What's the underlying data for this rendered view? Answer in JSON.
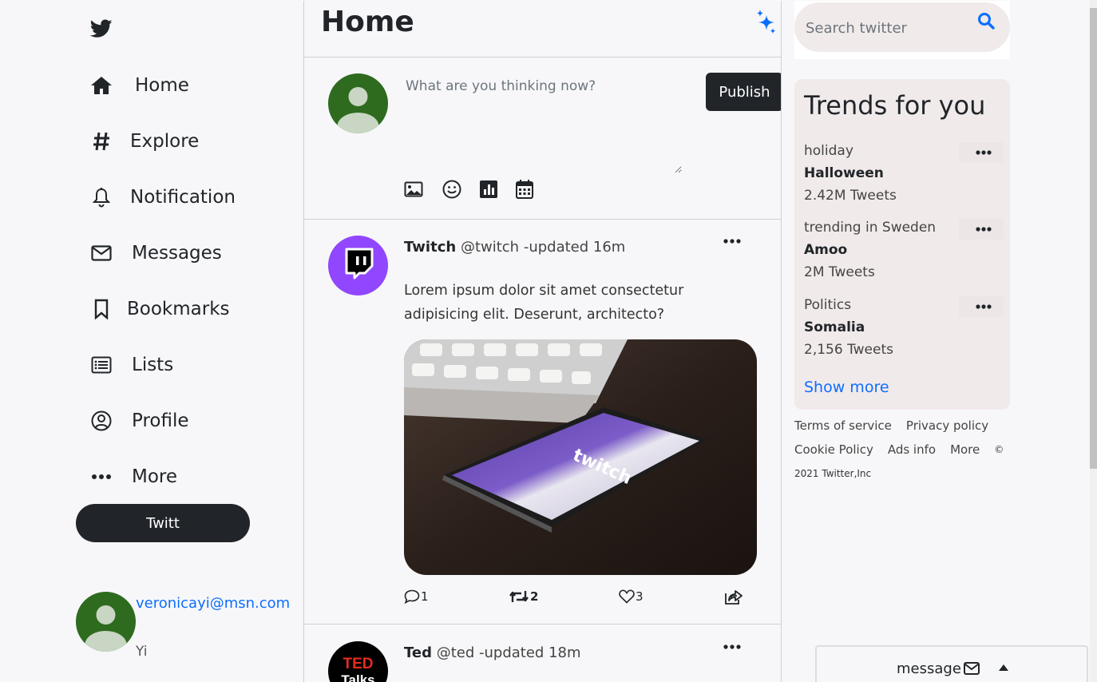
{
  "sidebar": {
    "logo": "twitter-bird-icon",
    "items": [
      {
        "label": "Home",
        "icon": "home-icon"
      },
      {
        "label": "Explore",
        "icon": "hashtag-icon"
      },
      {
        "label": "Notification",
        "icon": "bell-icon"
      },
      {
        "label": "Messages",
        "icon": "envelope-icon"
      },
      {
        "label": "Bookmarks",
        "icon": "bookmark-icon"
      },
      {
        "label": "Lists",
        "icon": "list-icon"
      },
      {
        "label": "Profile",
        "icon": "user-circle-icon"
      },
      {
        "label": "More",
        "icon": "ellipsis-icon"
      }
    ],
    "twitt_label": "Twitt",
    "user": {
      "email": "veronicayi@msn.com",
      "name": "Yi"
    }
  },
  "main": {
    "title": "Home",
    "composer": {
      "placeholder": "What are you thinking now?",
      "publish_label": "Publish",
      "tools": [
        "image-icon",
        "emoji-icon",
        "poll-icon",
        "calendar-icon"
      ]
    },
    "tweets": [
      {
        "author": "Twitch",
        "handle": "@twitch",
        "meta": "-updated 16m",
        "text": "Lorem ipsum dolor sit amet consectetur adipisicing elit. Deserunt, architecto?",
        "replies": "1",
        "retweets": "2",
        "likes": "3"
      },
      {
        "author": "Ted",
        "handle": "@ted",
        "meta": "-updated 18m"
      }
    ]
  },
  "right": {
    "search_placeholder": "Search twitter",
    "trends_title": "Trends for you",
    "trends": [
      {
        "category": "holiday",
        "name": "Halloween",
        "count": "2.42M Tweets"
      },
      {
        "category": "trending in Sweden",
        "name": "Amoo",
        "count": "2M Tweets"
      },
      {
        "category": "Politics",
        "name": "Somalia",
        "count": "2,156 Tweets"
      }
    ],
    "show_more": "Show more",
    "footer": {
      "links": [
        "Terms of service",
        "Privacy policy",
        "Cookie Policy",
        "Ads info",
        "More"
      ],
      "copyright_symbol": "©",
      "copyright": "2021 Twitter,Inc"
    },
    "message_bar": "message"
  },
  "colors": {
    "accent_blue": "#0d6efd",
    "dark": "#212529",
    "twitch_purple": "#9146ff",
    "avatar_green": "#2e6b1f",
    "trends_bg": "#f1eaea"
  }
}
